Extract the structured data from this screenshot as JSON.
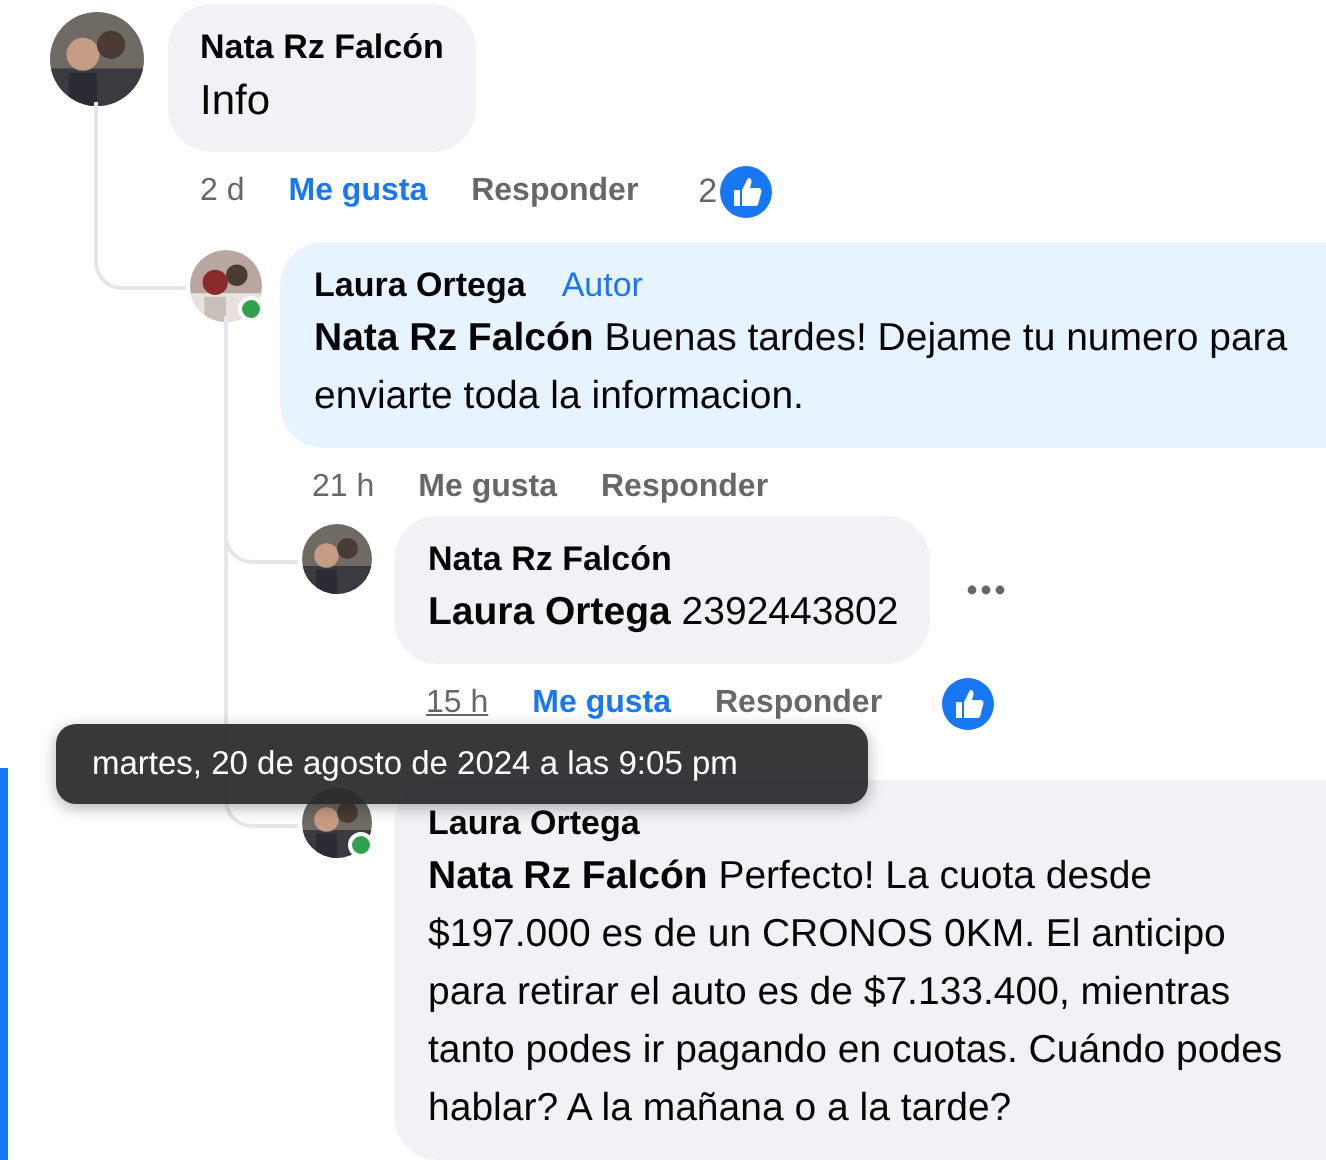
{
  "comments": [
    {
      "author": "Nata Rz Falcón",
      "text": "Info",
      "author_bubble": false,
      "actions": {
        "time": "2 d",
        "time_underlined": false,
        "like": "Me gusta",
        "liked": true,
        "reply": "Responder",
        "reaction": true,
        "reaction_count": "2"
      },
      "children": [
        {
          "author": "Laura Ortega",
          "author_badge": "Autor",
          "text": "**Nata Rz Falcón** Buenas tardes! Dejame tu numero para enviarte toda la informacion.",
          "online": true,
          "author_bubble": true,
          "actions": {
            "time": "21 h",
            "time_underlined": false,
            "like": "Me gusta",
            "liked": false,
            "reply": "Responder"
          },
          "children": [
            {
              "author": "Nata Rz Falcón",
              "text": "**Laura Ortega** 2392443802",
              "author_bubble": false,
              "more_button": true,
              "actions": {
                "time": "15 h",
                "time_underlined": true,
                "like": "Me gusta",
                "liked": true,
                "reply": "Responder",
                "reaction": true
              }
            },
            {
              "author": "Laura Ortega",
              "text": "**Nata Rz Falcón** Perfecto! La cuota desde $197.000 es de un CRONOS 0KM. El anticipo para retirar el auto es de $7.133.400, mientras tanto podes ir pagando en cuotas. Cuándo podes hablar? A la mañana o a la tarde?",
              "online": true,
              "author_bubble": false,
              "highlighted": true
            }
          ]
        }
      ]
    }
  ],
  "tooltip": "martes, 20 de agosto de 2024 a las 9:05 pm"
}
